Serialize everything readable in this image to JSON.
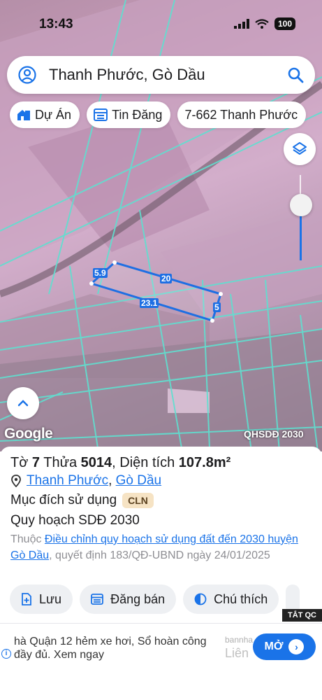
{
  "status": {
    "time": "13:43",
    "battery": "100"
  },
  "search": {
    "text": "Thanh Phước, Gò Dầu"
  },
  "chips": [
    {
      "label": "Dự Án",
      "icon": "house-icon"
    },
    {
      "label": "Tin Đăng",
      "icon": "listing-icon"
    },
    {
      "label": "7-662 Thanh Phước",
      "icon": ""
    }
  ],
  "map": {
    "google": "Google",
    "layer_label": "QHSDĐ 2030",
    "dimensions": [
      "5.9",
      "20",
      "23.1",
      "5"
    ],
    "accent": "#1a73e8"
  },
  "parcel": {
    "to_label": "Tờ",
    "to_value": "7",
    "thua_label": "Thửa",
    "thua_value": "5014",
    "area_label": "Diện tích",
    "area_value": "107.8m²",
    "ward": "Thanh Phước",
    "district": "Gò Dầu",
    "separator": ",",
    "purpose_label": "Mục đích sử dụng",
    "purpose_code": "CLN",
    "planning_label": "Quy hoạch SDĐ 2030",
    "note_prefix": "Thuộc",
    "note_link": "Điều chỉnh quy hoạch sử dụng đất đến 2030 huyện Gò Dầu",
    "note_suffix": ", quyết định 183/QĐ-UBND ngày 24/01/2025"
  },
  "actions": [
    {
      "label": "Lưu",
      "icon": "add-note-icon"
    },
    {
      "label": "Đăng bán",
      "icon": "listing-icon"
    },
    {
      "label": "Chú thích",
      "icon": "half-circle-icon"
    }
  ],
  "ad": {
    "close_label": "TẮT QC",
    "text": "hà Quận 12 hẻm xe hơi, Sổ hoàn công đầy đủ. Xem ngay",
    "domain": "bannha",
    "cta_background": "Liên",
    "cta": "MỞ"
  }
}
